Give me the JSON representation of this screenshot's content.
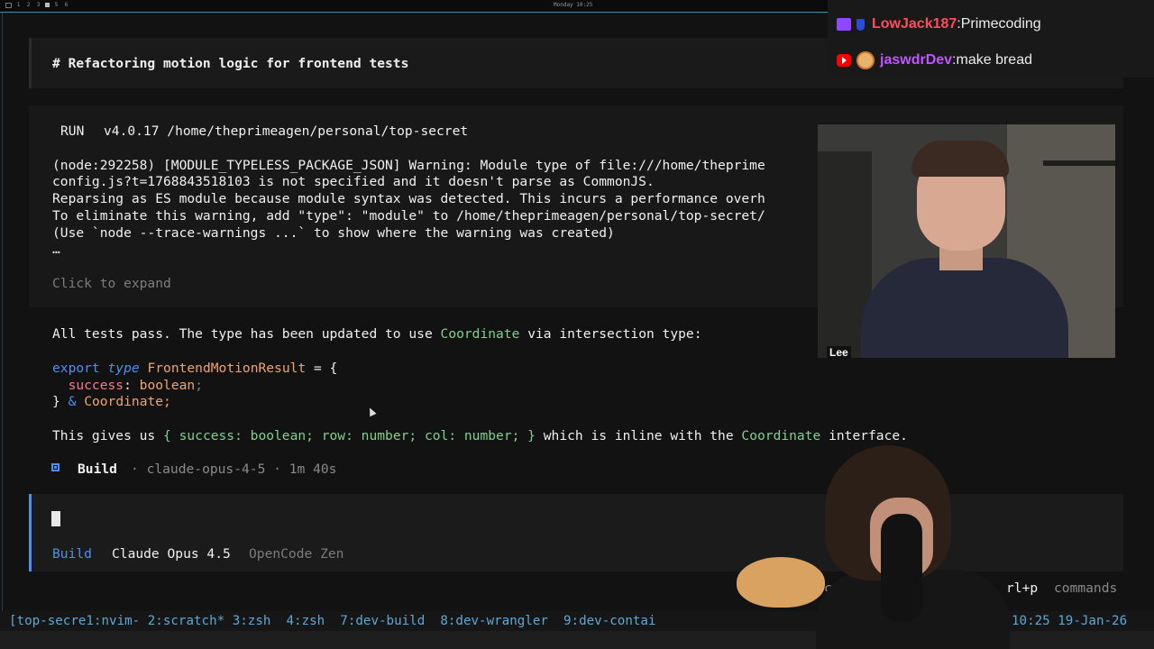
{
  "desktop": {
    "workspaces": [
      "1",
      "2",
      "3",
      "",
      "5",
      "6"
    ],
    "clock": "Monday 10:25"
  },
  "title_block": {
    "heading": "# Refactoring motion logic for frontend tests"
  },
  "run_block": {
    "run_label": "RUN",
    "run_version": "v4.0.17 /home/theprimeagen/personal/top-secret",
    "lines": [
      "(node:292258) [MODULE_TYPELESS_PACKAGE_JSON] Warning: Module type of file:///home/theprime",
      "config.js?t=1768843518103 is not specified and it doesn't parse as CommonJS.",
      "Reparsing as ES module because module syntax was detected. This incurs a performance overh",
      "To eliminate this warning, add \"type\": \"module\" to /home/theprimeagen/personal/top-secret/",
      "(Use `node --trace-warnings ...` to show where the warning was created)",
      "…"
    ],
    "expand": "Click to expand"
  },
  "message": {
    "summary_pre": "All tests pass. The type has been updated to use ",
    "summary_highlight": "Coordinate",
    "summary_post": " via intersection type:",
    "code": {
      "l1_export": "export",
      "l1_type": "type",
      "l1_name": "FrontendMotionResult",
      "l1_eq": " = {",
      "l2_key": "success",
      "l2_val": "boolean",
      "l3_close": "}",
      "l3_amp": "&",
      "l3_coord": "Coordinate;"
    },
    "gives_pre": "This gives us ",
    "gives_code": "{ success: boolean; row: number; col: number; }",
    "gives_mid": " which is inline with the ",
    "gives_highlight": "Coordinate",
    "gives_post": " interface."
  },
  "build_status": {
    "label": "Build",
    "detail": "· claude-opus-4-5 · 1m 40s"
  },
  "input": {
    "mode": "Build",
    "model": "Claude Opus 4.5",
    "provider": "OpenCode Zen"
  },
  "hints": {
    "partial": "ciants",
    "shortcut": "rl+p",
    "commands": "commands"
  },
  "tmux": {
    "windows": "[top-secre1:nvim- 2:scratch* 3:zsh  4:zsh  7:dev-build  8:dev-wrangler  9:dev-contai",
    "clock": "10:25 19-Jan-26"
  },
  "chat": {
    "messages": [
      {
        "user": "LowJack187",
        "text": "Primecoding"
      },
      {
        "user": "jaswdrDev",
        "text": "make bread"
      }
    ]
  },
  "webcam": {
    "label": "Lee"
  }
}
